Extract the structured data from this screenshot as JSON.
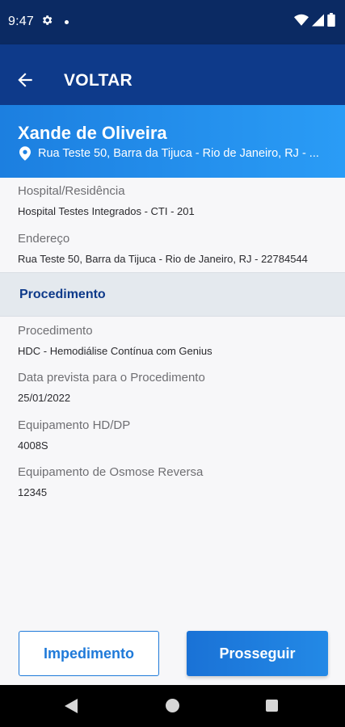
{
  "status_bar": {
    "time": "9:47",
    "icons": [
      "gear-icon",
      "notification-dot",
      "wifi-icon",
      "signal-icon",
      "battery-icon"
    ]
  },
  "app_bar": {
    "title": "VOLTAR",
    "back_icon": "arrow-left-icon"
  },
  "patient": {
    "name": "Xande de Oliveira",
    "address": "Rua Teste 50, Barra da Tijuca - Rio de Janeiro, RJ - ...",
    "pin_icon": "location-pin-icon"
  },
  "details": {
    "hospital_label": "Hospital/Residência",
    "hospital_value": "Hospital Testes Integrados - CTI - 201",
    "address_label": "Endereço",
    "address_value": "Rua Teste 50, Barra da Tijuca - Rio de Janeiro, RJ - 22784544"
  },
  "section": {
    "title": "Procedimento"
  },
  "procedure": {
    "procedure_label": "Procedimento",
    "procedure_value": "HDC - Hemodiálise Contínua com Genius",
    "date_label": "Data prevista para o Procedimento",
    "date_value": "25/01/2022",
    "hd_label": "Equipamento HD/DP",
    "hd_value": "4008S",
    "osmosis_label": "Equipamento de Osmose Reversa",
    "osmosis_value": "12345"
  },
  "actions": {
    "impediment": "Impedimento",
    "proceed": "Prosseguir"
  },
  "colors": {
    "status_bar": "#0b2a63",
    "app_bar": "#0e3a8a",
    "header_start": "#1c7fe0",
    "header_end": "#2a9cf6",
    "accent": "#1f7ad9"
  }
}
